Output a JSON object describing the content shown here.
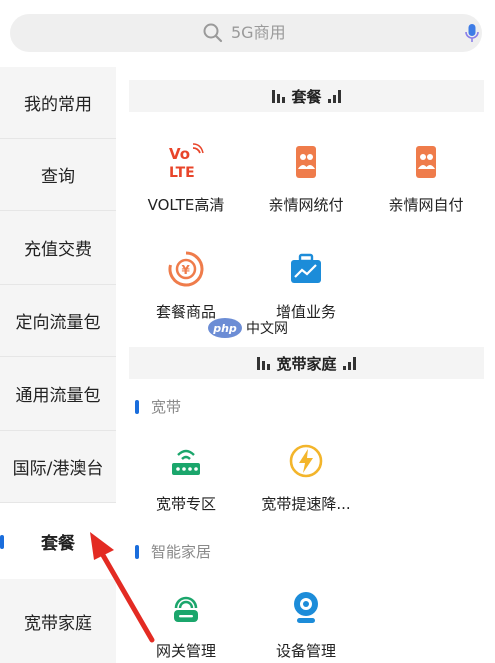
{
  "search": {
    "placeholder": "5G商用"
  },
  "sidebar": {
    "items": [
      {
        "label": "我的常用"
      },
      {
        "label": "查询"
      },
      {
        "label": "充值交费"
      },
      {
        "label": "定向流量包"
      },
      {
        "label": "通用流量包"
      },
      {
        "label": "国际/港澳台"
      },
      {
        "label": "套餐",
        "active": true
      },
      {
        "label": "宽带家庭"
      }
    ]
  },
  "sections": {
    "package": {
      "title": "套餐",
      "items": [
        {
          "label": "VOLTE高清",
          "icon": "volte-icon"
        },
        {
          "label": "亲情网统付",
          "icon": "family-card-icon"
        },
        {
          "label": "亲情网自付",
          "icon": "family-card-icon"
        },
        {
          "label": "套餐商品",
          "icon": "package-goods-icon"
        },
        {
          "label": "增值业务",
          "icon": "briefcase-icon"
        }
      ]
    },
    "broadband_home": {
      "title": "宽带家庭",
      "broadband": {
        "heading": "宽带",
        "items": [
          {
            "label": "宽带专区",
            "icon": "router-icon"
          },
          {
            "label": "宽带提速降...",
            "icon": "lightning-icon"
          }
        ]
      },
      "smart_home": {
        "heading": "智能家居",
        "items": [
          {
            "label": "网关管理",
            "icon": "gateway-icon"
          },
          {
            "label": "设备管理",
            "icon": "camera-icon"
          }
        ]
      }
    }
  },
  "watermark": {
    "badge": "php",
    "text": "中文网"
  },
  "colors": {
    "accent": "#1a6ddc",
    "red": "#e8452a",
    "orange": "#ef7c4b",
    "green": "#1ba66c",
    "blue": "#1c8cd9",
    "yellow": "#f3b52b"
  }
}
